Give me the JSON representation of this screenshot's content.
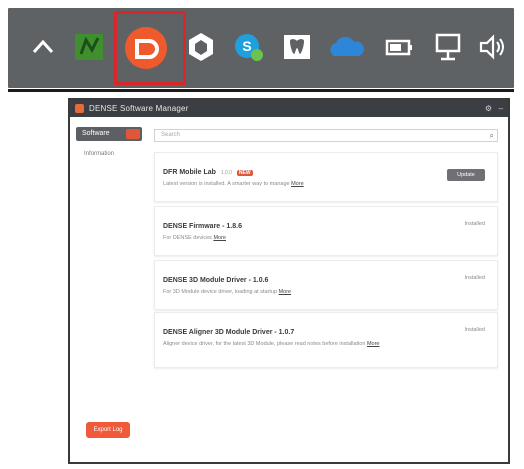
{
  "tray": {
    "icons": [
      {
        "name": "chevron-up-icon"
      },
      {
        "name": "green-app-icon",
        "color": "#3f8f2f"
      },
      {
        "name": "dji-assistant-icon",
        "color": "#ee5a2b"
      },
      {
        "name": "shield-app-icon"
      },
      {
        "name": "skype-icon",
        "color": "#1fa0dc"
      },
      {
        "name": "tooth-app-icon"
      },
      {
        "name": "onedrive-cloud-icon",
        "color": "#2e86d8"
      },
      {
        "name": "battery-icon"
      },
      {
        "name": "network-icon"
      },
      {
        "name": "volume-icon"
      }
    ],
    "highlight_color": "#d9262c"
  },
  "window": {
    "title": "DENSE Software Manager",
    "controls": {
      "settings": "⚙",
      "minimize": "–"
    },
    "sidebar": {
      "tab_label": "Software",
      "item_label": "Information",
      "bottom_button": "Export Log"
    },
    "search": {
      "placeholder": "Search"
    },
    "cards": [
      {
        "name": "DFR Mobile Lab",
        "tag": "1.0.0",
        "badge": "NEW",
        "description": "Latest version is installed. A smarter way to manage",
        "more": "More",
        "action": "Update"
      },
      {
        "name": "DENSE Firmware - 1.8.6",
        "description": "For DENSE devices",
        "more": "More",
        "status": "Installed"
      },
      {
        "name": "DENSE 3D Module Driver - 1.0.6",
        "description": "For 3D Module device driver, loading at startup",
        "more": "More",
        "status": "Installed"
      },
      {
        "name": "DENSE Aligner 3D Module Driver - 1.0.7",
        "description": "Aligner device driver, for the latest 3D Module, please read notes before installation",
        "more": "More",
        "status": "Installed"
      }
    ]
  }
}
